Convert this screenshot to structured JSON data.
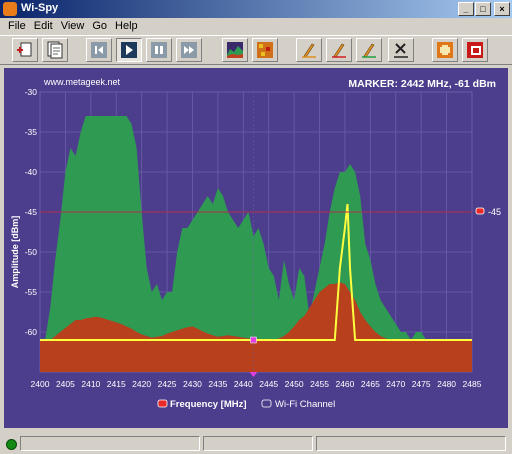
{
  "window": {
    "title": "Wi-Spy",
    "buttons": [
      "_",
      "□",
      "×"
    ]
  },
  "menu": {
    "items": [
      "File",
      "Edit",
      "View",
      "Go",
      "Help"
    ]
  },
  "toolbar": {
    "buttons": [
      {
        "name": "new-icon"
      },
      {
        "name": "properties-icon"
      },
      {
        "name": "skip-back-icon"
      },
      {
        "name": "play-icon"
      },
      {
        "name": "pause-icon"
      },
      {
        "name": "skip-forward-icon"
      },
      {
        "name": "topographic-view-icon"
      },
      {
        "name": "density-view-icon"
      },
      {
        "name": "orange-pencil-icon"
      },
      {
        "name": "red-pencil-icon"
      },
      {
        "name": "green-pencil-icon"
      },
      {
        "name": "clear-traces-icon"
      },
      {
        "name": "zoom-icon"
      },
      {
        "name": "record-icon"
      }
    ]
  },
  "header": {
    "site": "www.metageek.net",
    "marker": "MARKER: 2442 MHz, -61 dBm"
  },
  "colors": {
    "background": "#4c3e8c",
    "max_hold": "#2e9a52",
    "average": "#b8401c",
    "current": "#ffff40",
    "threshold_line": "#b03050",
    "marker": "#e040e0"
  },
  "chart_data": {
    "type": "area",
    "ylabel": "Amplitude [dBm]",
    "xlabel": "",
    "xlim": [
      2400,
      2485
    ],
    "ylim": [
      -65,
      -30
    ],
    "x_ticks": [
      2400,
      2405,
      2410,
      2415,
      2420,
      2425,
      2430,
      2435,
      2440,
      2445,
      2450,
      2455,
      2460,
      2465,
      2470,
      2475,
      2480,
      2485
    ],
    "y_ticks": [
      -30,
      -35,
      -40,
      -45,
      -50,
      -55,
      -60
    ],
    "grid": true,
    "threshold": {
      "value": -45,
      "label": "-45"
    },
    "marker": {
      "frequency": 2442,
      "amplitude": -61
    },
    "legend": {
      "position": "bottom",
      "items": [
        "Frequency [MHz]",
        "Wi-Fi Channel"
      ]
    },
    "series": [
      {
        "x": [
          2400,
          2401,
          2402,
          2403,
          2404,
          2405,
          2406,
          2407,
          2408,
          2409,
          2410,
          2411,
          2412,
          2413,
          2414,
          2415,
          2416,
          2417,
          2418,
          2419,
          2420,
          2421,
          2422,
          2423,
          2424,
          2425,
          2426,
          2427,
          2428,
          2429,
          2430,
          2431,
          2432,
          2433,
          2434,
          2435,
          2436,
          2437,
          2438,
          2439,
          2440,
          2441,
          2442,
          2443,
          2444,
          2445,
          2446,
          2447,
          2448,
          2449,
          2450,
          2451,
          2452,
          2453,
          2454,
          2455,
          2456,
          2457,
          2458,
          2459,
          2460,
          2461,
          2462,
          2463,
          2464,
          2465,
          2466,
          2467,
          2468,
          2469,
          2470,
          2471,
          2472,
          2473,
          2474,
          2475,
          2476,
          2477,
          2478,
          2479,
          2480,
          2481,
          2482,
          2483,
          2484,
          2485
        ],
        "values": [
          -61,
          -61,
          -57,
          -51,
          -46,
          -40,
          -37,
          -38,
          -35,
          -33,
          -33,
          -33,
          -33,
          -33,
          -33,
          -33,
          -33,
          -33,
          -34,
          -37,
          -45,
          -52,
          -55,
          -54,
          -56,
          -55,
          -55,
          -50,
          -47,
          -47,
          -46,
          -45,
          -44,
          -43,
          -44,
          -42,
          -43,
          -45,
          -46,
          -47,
          -46,
          -45,
          -48,
          -47,
          -49,
          -52,
          -53,
          -56,
          -51,
          -54,
          -56,
          -52,
          -53,
          -58,
          -55,
          -52,
          -49,
          -45,
          -42,
          -40,
          -40,
          -39,
          -40,
          -43,
          -49,
          -51,
          -54,
          -56,
          -57,
          -58,
          -59,
          -60,
          -60,
          -61,
          -60,
          -60,
          -61,
          -61,
          -61,
          -61,
          -61,
          -61,
          -61,
          -61,
          -61,
          -61
        ]
      },
      {
        "x": [
          2400,
          2401,
          2402,
          2403,
          2404,
          2405,
          2406,
          2407,
          2408,
          2409,
          2410,
          2411,
          2412,
          2413,
          2414,
          2415,
          2416,
          2417,
          2418,
          2419,
          2420,
          2421,
          2422,
          2423,
          2424,
          2425,
          2426,
          2427,
          2428,
          2429,
          2430,
          2431,
          2432,
          2433,
          2434,
          2435,
          2436,
          2437,
          2438,
          2439,
          2440,
          2441,
          2442,
          2443,
          2444,
          2445,
          2446,
          2447,
          2448,
          2449,
          2450,
          2451,
          2452,
          2453,
          2454,
          2455,
          2456,
          2457,
          2458,
          2459,
          2460,
          2461,
          2462,
          2463,
          2464,
          2465,
          2466,
          2467,
          2468,
          2469,
          2470,
          2471,
          2472,
          2473,
          2474,
          2475,
          2476,
          2477,
          2478,
          2479,
          2480,
          2481,
          2482,
          2483,
          2484,
          2485
        ],
        "values": [
          -61,
          -61,
          -61,
          -60.5,
          -60,
          -59.5,
          -59,
          -58.5,
          -58.5,
          -58.3,
          -58.2,
          -58.1,
          -58.2,
          -58.4,
          -58.6,
          -58.8,
          -59,
          -59.3,
          -59.6,
          -60,
          -60.3,
          -60.5,
          -60.7,
          -60.6,
          -60.5,
          -60.2,
          -60,
          -59.8,
          -59.6,
          -59.4,
          -59.3,
          -59.6,
          -59.9,
          -60.2,
          -60.4,
          -60.6,
          -60.5,
          -60.4,
          -60.5,
          -60.6,
          -60.7,
          -60.8,
          -61,
          -60.9,
          -61,
          -61,
          -61,
          -60.8,
          -60.5,
          -60,
          -59.3,
          -58.5,
          -58,
          -57,
          -56,
          -55,
          -54.5,
          -54,
          -54,
          -53.8,
          -54,
          -55,
          -56,
          -57.5,
          -58.5,
          -59.3,
          -60,
          -60.5,
          -60.8,
          -61,
          -61,
          -61,
          -61,
          -61,
          -61,
          -61,
          -61,
          -61,
          -61,
          -61,
          -61,
          -61,
          -61,
          -61,
          -61,
          -61
        ]
      },
      {
        "x": [
          2400,
          2454,
          2456,
          2458,
          2459,
          2460,
          2460.5,
          2461,
          2462,
          2485
        ],
        "values": [
          -61,
          -61,
          -61,
          -61,
          -52,
          -47,
          -44,
          -52,
          -61,
          -61
        ]
      }
    ]
  },
  "status": {
    "segments": [
      "",
      "",
      ""
    ]
  }
}
